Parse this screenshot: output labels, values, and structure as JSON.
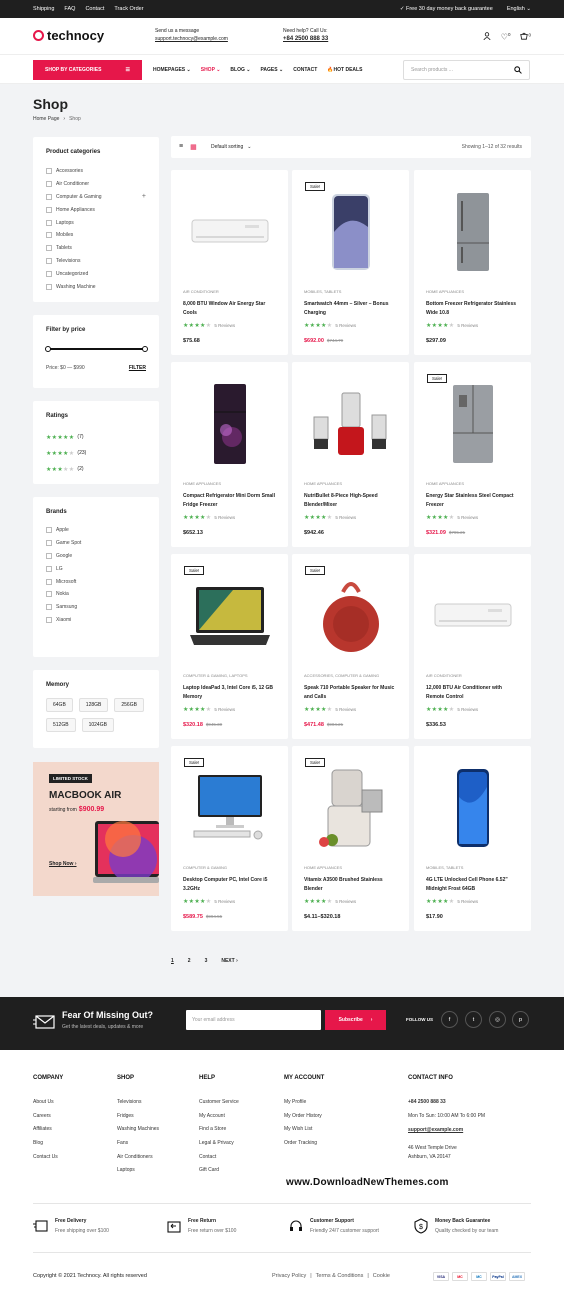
{
  "topbar": {
    "links": [
      "Shipping",
      "FAQ",
      "Contact",
      "Track Order"
    ],
    "promo": "Free 30 day money back guarantee",
    "language": "English"
  },
  "header": {
    "logo": "technocy",
    "message_label": "Send us a message",
    "message_email": "support.technocy@example.com",
    "help_label": "Need help? Call Us:",
    "help_phone": "+84 2500 888 33",
    "wishlist_count": "0",
    "cart_count": "0"
  },
  "nav": {
    "categories_button": "SHOP BY CATEGORIES",
    "menu": [
      "HOMEPAGES",
      "SHOP",
      "BLOG",
      "PAGES",
      "CONTACT",
      "HOT DEALS"
    ],
    "search_placeholder": "Search products ..."
  },
  "page": {
    "title": "Shop",
    "breadcrumb_home": "Home Page",
    "breadcrumb_current": "Shop"
  },
  "sidebar": {
    "categories_title": "Product categories",
    "categories": [
      "Accessories",
      "Air Conditioner",
      "Computer & Gaming",
      "Home Appliances",
      "Laptops",
      "Mobiles",
      "Tablets",
      "Televisions",
      "Uncategorized",
      "Washing Machine"
    ],
    "price_title": "Filter by price",
    "price_label": "Price: $0 — $990",
    "price_filter_button": "FILTER",
    "ratings_title": "Ratings",
    "ratings": [
      {
        "stars": 5,
        "count": "(7)"
      },
      {
        "stars": 4,
        "count": "(23)"
      },
      {
        "stars": 3,
        "count": "(2)"
      }
    ],
    "brands_title": "Brands",
    "brands": [
      "Apple",
      "Game Spot",
      "Google",
      "LG",
      "Microsoft",
      "Nokia",
      "Samsung",
      "Xiaomi"
    ],
    "memory_title": "Memory",
    "memory": [
      "64GB",
      "128GB",
      "256GB",
      "512GB",
      "1024GB"
    ],
    "banner": {
      "tag": "LIMITED STOCK",
      "title": "MACBOOK AIR",
      "price_prefix": "starting from",
      "price": "$900.99",
      "cta": "Shop Now"
    }
  },
  "toolbar": {
    "sort": "Default sorting",
    "results": "Showing 1–12 of 32 results"
  },
  "products": [
    {
      "category": "AIR CONDITIONER",
      "name": "8,000 BTU Window Air Energy Star Cools",
      "reviews": "5 Reviews",
      "price": "$75.68",
      "old_price": "",
      "sale": false,
      "img": "ac"
    },
    {
      "category": "MOBILES, TABLETS",
      "name": "Smartwatch 44mm – Silver – Bonus Charging",
      "reviews": "5 Reviews",
      "price": "$692.00",
      "old_price": "$744.79",
      "sale": true,
      "img": "phone"
    },
    {
      "category": "HOME APPLIANCES",
      "name": "Bottom Freezer Refrigerator Stainless Wide 10.8",
      "reviews": "5 Reviews",
      "price": "$297.09",
      "old_price": "",
      "sale": false,
      "img": "fridge"
    },
    {
      "category": "HOME APPLIANCES",
      "name": "Compact Refrigerator Mini Dorm Small Fridge Freezer",
      "reviews": "5 Reviews",
      "price": "$652.13",
      "old_price": "",
      "sale": false,
      "img": "minifridge"
    },
    {
      "category": "HOME APPLIANCES",
      "name": "NutriBullet 8-Piece High-Speed Blender/Mixer",
      "reviews": "5 Reviews",
      "price": "$942.46",
      "old_price": "",
      "sale": false,
      "img": "blender"
    },
    {
      "category": "HOME APPLIANCES",
      "name": "Energy Star Stainless Steel Compact Freezer",
      "reviews": "5 Reviews",
      "price": "$321.09",
      "old_price": "$795.21",
      "sale": true,
      "img": "doublefridge"
    },
    {
      "category": "COMPUTER & GAMING, LAPTOPS",
      "name": "Laptop IdeaPad 3, Intel Core i5, 12 GB Memory",
      "reviews": "5 Reviews",
      "price": "$320.18",
      "old_price": "$945.30",
      "sale": true,
      "img": "laptop"
    },
    {
      "category": "ACCESSORIES, COMPUTER & GAMING",
      "name": "Speak 710 Portable Speaker for Music and Calls",
      "reviews": "5 Reviews",
      "price": "$471.48",
      "old_price": "$904.21",
      "sale": true,
      "img": "speaker"
    },
    {
      "category": "AIR CONDITIONER",
      "name": "12,000 BTU Air Conditioner with Remote Control",
      "reviews": "5 Reviews",
      "price": "$336.53",
      "old_price": "",
      "sale": false,
      "img": "ac"
    },
    {
      "category": "COMPUTER & GAMING",
      "name": "Desktop Computer PC, Intel Core i5 3.2GHz",
      "reviews": "5 Reviews",
      "price": "$589.75",
      "old_price": "$994.55",
      "sale": true,
      "img": "desktop"
    },
    {
      "category": "HOME APPLIANCES",
      "name": "Vitamix A3500 Brushed Stainless Blender",
      "reviews": "5 Reviews",
      "price": "$4.11–$320.18",
      "old_price": "",
      "sale": true,
      "img": "juicer"
    },
    {
      "category": "MOBILES, TABLETS",
      "name": "4G LTE Unlocked Cell Phone 6.52\" Midnight Frost 64GB",
      "reviews": "5 Reviews",
      "price": "$17.90",
      "old_price": "",
      "sale": false,
      "img": "bluephone"
    }
  ],
  "pagination": [
    "1",
    "2",
    "3",
    "NEXT"
  ],
  "sale_label": "Sale!",
  "newsletter": {
    "title": "Fear Of Missing Out?",
    "subtitle": "Get the latest deals, updates & more",
    "placeholder": "Your email address",
    "button": "Subscribe",
    "follow": "FOLLOW US"
  },
  "footer": {
    "company_title": "COMPANY",
    "company": [
      "About Us",
      "Careers",
      "Affiliates",
      "Blog",
      "Contact Us"
    ],
    "shop_title": "SHOP",
    "shop": [
      "Televisions",
      "Fridges",
      "Washing Machines",
      "Fans",
      "Air Conditioners",
      "Laptops"
    ],
    "help_title": "HELP",
    "help": [
      "Customer Service",
      "My Account",
      "Find a Store",
      "Legal & Privacy",
      "Contact",
      "Gift Card"
    ],
    "account_title": "MY ACCOUNT",
    "account": [
      "My Profile",
      "My Order History",
      "My Wish List",
      "Order Tracking"
    ],
    "contact_title": "CONTACT INFO",
    "contact_phone": "+84 2500 888 33",
    "contact_hours": "Mon To Sun: 10:00 AM To 6:00 PM",
    "contact_email": "support@example.com",
    "contact_address1": "46 West Temple Drive",
    "contact_address2": "Ashburn, VA 20147",
    "watermark": "www.DownloadNewThemes.com",
    "features": [
      {
        "title": "Free Delivery",
        "desc": "Free shipping over $100"
      },
      {
        "title": "Free Return",
        "desc": "Free return over $100"
      },
      {
        "title": "Customer Support",
        "desc": "Friendly 24/7 customer support"
      },
      {
        "title": "Money Back Guarantee",
        "desc": "Quality checked by our team"
      }
    ],
    "copyright": "Copyright © 2021 Technocy. All rights reserved",
    "links": [
      "Privacy Policy",
      "Terms & Conditions",
      "Cookie"
    ],
    "payments": [
      "VISA",
      "MC",
      "MC",
      "PayPal",
      "AMEX"
    ]
  },
  "colors": {
    "accent": "#e6174a",
    "rating": "#4caf50",
    "dark": "#1f1f1f"
  }
}
